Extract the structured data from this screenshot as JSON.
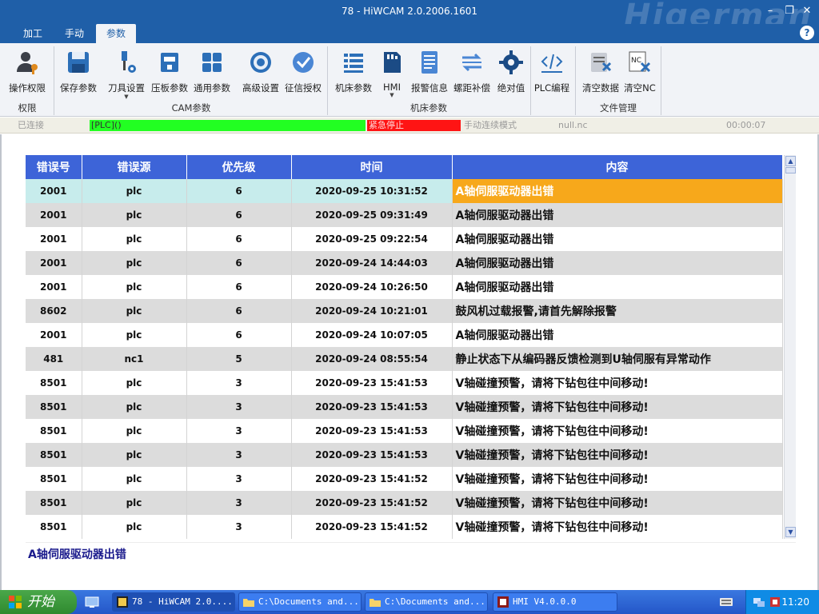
{
  "window": {
    "title": "78 - HiWCAM 2.0.2006.1601",
    "watermark": "Higerman"
  },
  "menu": {
    "tabs": [
      "加工",
      "手动",
      "参数"
    ],
    "active_index": 2
  },
  "ribbon": {
    "buttons": [
      {
        "label": "操作权限",
        "icon": "user-key-icon"
      },
      {
        "label": "保存参数",
        "icon": "floppy-disk-icon"
      },
      {
        "label": "刀具设置",
        "icon": "tool-settings-icon",
        "dropdown": true
      },
      {
        "label": "压板参数",
        "icon": "clamp-icon"
      },
      {
        "label": "通用参数",
        "icon": "grid-icon"
      },
      {
        "label": "高级设置",
        "icon": "advanced-gear-icon"
      },
      {
        "label": "征信授权",
        "icon": "check-circle-icon"
      },
      {
        "label": "机床参数",
        "icon": "list-icon"
      },
      {
        "label": "HMI",
        "icon": "sd-card-icon",
        "dropdown": true
      },
      {
        "label": "报警信息",
        "icon": "document-icon"
      },
      {
        "label": "螺距补偿",
        "icon": "arrows-icon"
      },
      {
        "label": "绝对值",
        "icon": "gear-icon"
      },
      {
        "label": "PLC编程",
        "icon": "code-icon"
      },
      {
        "label": "清空数据",
        "icon": "clear-data-icon"
      },
      {
        "label": "清空NC",
        "icon": "clear-nc-icon"
      }
    ],
    "groups": [
      "权限",
      "CAM参数",
      "机床参数",
      "文件管理"
    ]
  },
  "status": {
    "connection": "已连接",
    "plc": "[PLC]()",
    "emergency": "紧急停止",
    "mode": "手动连续模式",
    "file": "null.nc",
    "timer": "00:00:07"
  },
  "colors": {
    "title_blue": "#1f5fa8",
    "header_blue": "#3d64d8",
    "highlight_orange": "#f7a81b",
    "status_green": "#22ff22",
    "status_red": "#ff1414"
  },
  "alarm_table": {
    "columns": [
      "错误号",
      "错误源",
      "优先级",
      "时间",
      "内容"
    ],
    "selected_index": 0,
    "rows": [
      [
        "2001",
        "plc",
        "6",
        "2020-09-25 10:31:52",
        "A轴伺服驱动器出错"
      ],
      [
        "2001",
        "plc",
        "6",
        "2020-09-25 09:31:49",
        "A轴伺服驱动器出错"
      ],
      [
        "2001",
        "plc",
        "6",
        "2020-09-25 09:22:54",
        "A轴伺服驱动器出错"
      ],
      [
        "2001",
        "plc",
        "6",
        "2020-09-24 14:44:03",
        "A轴伺服驱动器出错"
      ],
      [
        "2001",
        "plc",
        "6",
        "2020-09-24 10:26:50",
        "A轴伺服驱动器出错"
      ],
      [
        "8602",
        "plc",
        "6",
        "2020-09-24 10:21:01",
        "鼓风机过载报警,请首先解除报警"
      ],
      [
        "2001",
        "plc",
        "6",
        "2020-09-24 10:07:05",
        "A轴伺服驱动器出错"
      ],
      [
        "481",
        "nc1",
        "5",
        "2020-09-24 08:55:54",
        "静止状态下从编码器反馈检测到U轴伺服有异常动作"
      ],
      [
        "8501",
        "plc",
        "3",
        "2020-09-23 15:41:53",
        "V轴碰撞预警，请将下钻包往中间移动!"
      ],
      [
        "8501",
        "plc",
        "3",
        "2020-09-23 15:41:53",
        "V轴碰撞预警，请将下钻包往中间移动!"
      ],
      [
        "8501",
        "plc",
        "3",
        "2020-09-23 15:41:53",
        "V轴碰撞预警，请将下钻包往中间移动!"
      ],
      [
        "8501",
        "plc",
        "3",
        "2020-09-23 15:41:53",
        "V轴碰撞预警，请将下钻包往中间移动!"
      ],
      [
        "8501",
        "plc",
        "3",
        "2020-09-23 15:41:52",
        "V轴碰撞预警，请将下钻包往中间移动!"
      ],
      [
        "8501",
        "plc",
        "3",
        "2020-09-23 15:41:52",
        "V轴碰撞预警，请将下钻包往中间移动!"
      ],
      [
        "8501",
        "plc",
        "3",
        "2020-09-23 15:41:52",
        "V轴碰撞预警，请将下钻包往中间移动!"
      ]
    ]
  },
  "detail": {
    "text": "A轴伺服驱动器出错"
  },
  "taskbar": {
    "start_label": "开始",
    "tasks": [
      {
        "label": "78 - HiWCAM 2.0....",
        "icon": "hiwcam-icon"
      },
      {
        "label": "C:\\Documents and...",
        "icon": "folder-icon"
      },
      {
        "label": "C:\\Documents and...",
        "icon": "folder-icon"
      },
      {
        "label": "HMI V4.0.0.0",
        "icon": "hmi-icon"
      }
    ],
    "clock": "11:20"
  }
}
